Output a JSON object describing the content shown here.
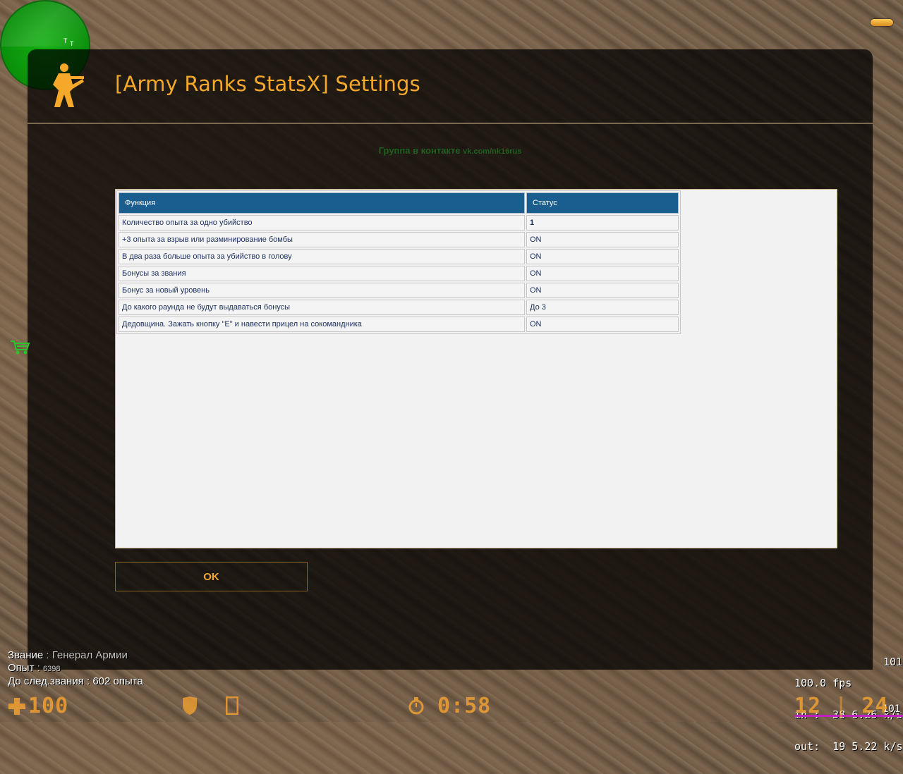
{
  "dialog": {
    "title": "[Army Ranks StatsX] Settings",
    "group_text": "Группа в контакте",
    "group_link": "vk.com/nk16rus",
    "ok_label": "OK"
  },
  "table": {
    "headers": [
      "Функция",
      "Статус"
    ],
    "rows": [
      {
        "function": "Количество опыта за одно убийство",
        "status": "1"
      },
      {
        "function": "+3 опыта за взрыв или разминирование бомбы",
        "status": "ON"
      },
      {
        "function": "В два раза больше опыта за убийство в голову",
        "status": "ON"
      },
      {
        "function": "Бонусы за звания",
        "status": "ON"
      },
      {
        "function": "Бонус за новый уровень",
        "status": "ON"
      },
      {
        "function": "До какого раунда не будут выдаваться бонусы",
        "status": "До 3"
      },
      {
        "function": "Дедовщина. Зажать кнопку \"E\" и навести прицел на сокомандника",
        "status": "ON"
      }
    ]
  },
  "rank_info": {
    "rank_label": "Звание",
    "rank_value": "Генерал Армии",
    "exp_label": "Опыт",
    "exp_value": "6398",
    "next_label": "До след.звания",
    "next_value": "602 опыта"
  },
  "netgraph": {
    "fps": "100.0 fps",
    "in": "in :  38 6.26 k/s",
    "out": "out:  19 5.22 k/s",
    "right_top": "101",
    "right_bottom": "101"
  },
  "hud": {
    "health": "100",
    "timer": "0:58",
    "ammo_clip": "12",
    "ammo_reserve": "24"
  },
  "colors": {
    "accent": "#f5a82a",
    "table_header": "#1a5d8f",
    "status_on": "#1a8a1a",
    "status_warn": "#cc1a1a",
    "radar": "#0a8f0a"
  }
}
